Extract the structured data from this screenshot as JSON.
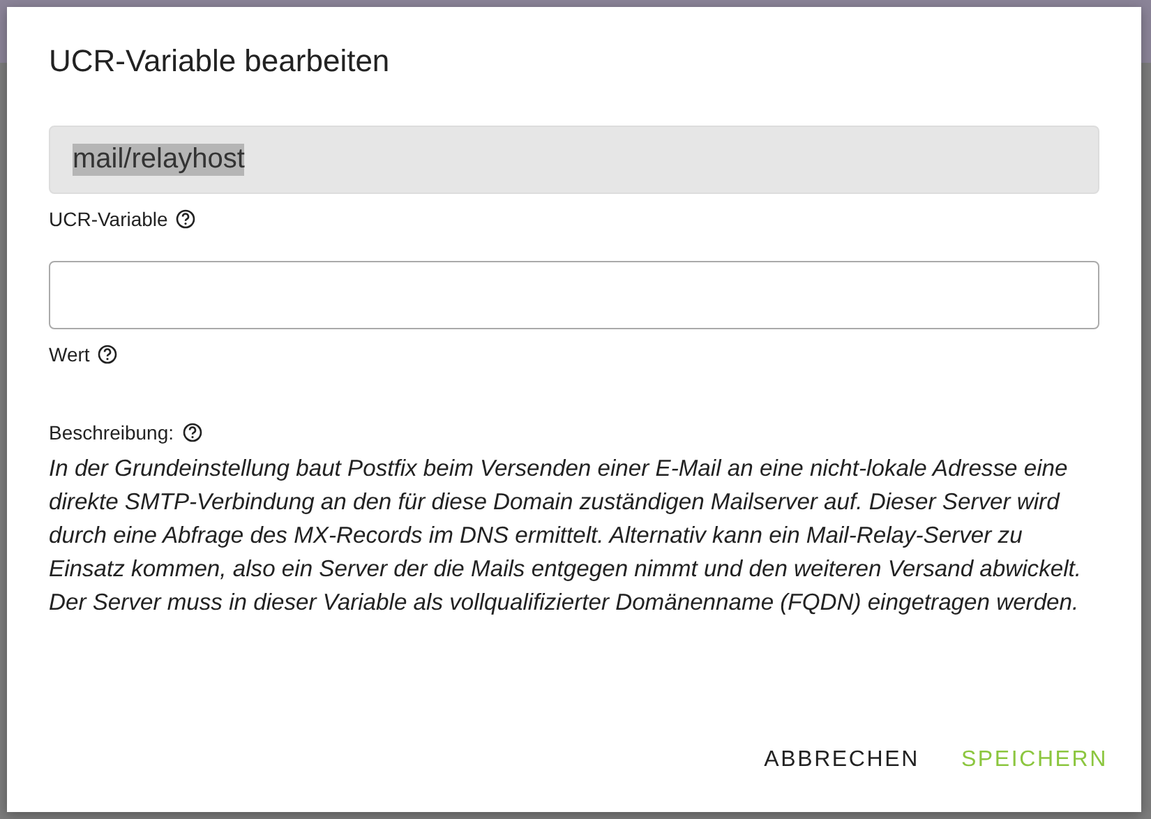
{
  "dialog": {
    "title": "UCR-Variable bearbeiten",
    "fields": [
      {
        "kind": "readonly",
        "value": "mail/relayhost",
        "text_selected": true,
        "label": "UCR-Variable"
      },
      {
        "kind": "input",
        "label": "Wert"
      }
    ],
    "description": {
      "label": "Beschreibung:",
      "text": "In der Grundeinstellung baut Postfix beim Versenden einer E-Mail an eine nicht-lokale Adresse eine direkte SMTP-Verbindung an den für diese Domain zuständigen Mailserver auf. Dieser Server wird durch eine Abfrage des MX-Records im DNS ermittelt. Alternativ kann ein Mail-Relay-Server zu Einsatz kommen, also ein Server der die Mails entgegen nimmt und den weiteren Versand abwickelt. Der Server muss in dieser Variable als vollqualifizierter Domänenname (FQDN) eingetragen werden."
    },
    "buttons": [
      {
        "label": "ABBRECHEN",
        "kind": "secondary"
      },
      {
        "label": "SPEICHERN",
        "kind": "primary"
      }
    ]
  }
}
